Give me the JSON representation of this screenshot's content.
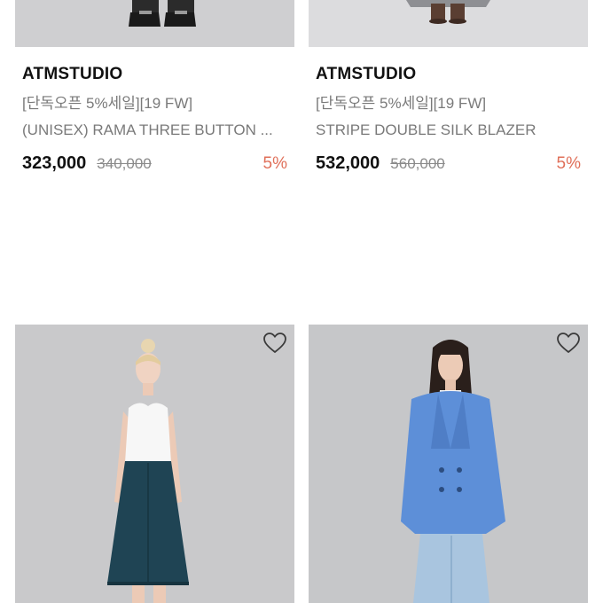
{
  "products": [
    {
      "brand": "ATMSTUDIO",
      "promo": "[단독오픈 5%세일][19 FW]",
      "name": "(UNISEX) RAMA THREE BUTTON ...",
      "price": "323,000",
      "original_price": "340,000",
      "discount": "5%"
    },
    {
      "brand": "ATMSTUDIO",
      "promo": "[단독오픈 5%세일][19 FW]",
      "name": "STRIPE DOUBLE SILK BLAZER",
      "price": "532,000",
      "original_price": "560,000",
      "discount": "5%"
    },
    {
      "icon": "heart-outline-icon"
    },
    {
      "icon": "heart-outline-icon"
    }
  ],
  "colors": {
    "image_bg": "#cfcfd1",
    "discount": "#e0705a",
    "muted_text": "#7a7a7a"
  }
}
